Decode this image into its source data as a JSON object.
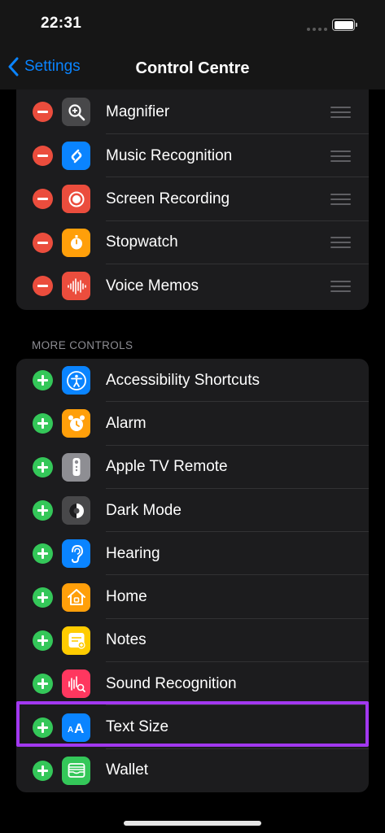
{
  "status_bar": {
    "time": "22:31"
  },
  "nav": {
    "back_label": "Settings",
    "title": "Control Centre"
  },
  "included_controls": [
    {
      "label": "Magnifier",
      "icon": "magnifier-icon",
      "color": "#48484a"
    },
    {
      "label": "Music Recognition",
      "icon": "shazam-icon",
      "color": "#0a84ff"
    },
    {
      "label": "Screen Recording",
      "icon": "screen-recording-icon",
      "color": "#eb4d3d"
    },
    {
      "label": "Stopwatch",
      "icon": "stopwatch-icon",
      "color": "#ff9f0a"
    },
    {
      "label": "Voice Memos",
      "icon": "voice-memos-icon",
      "color": "#eb4d3d"
    }
  ],
  "more_controls": {
    "header": "MORE CONTROLS",
    "items": [
      {
        "label": "Accessibility Shortcuts",
        "icon": "accessibility-icon",
        "color": "#0a84ff"
      },
      {
        "label": "Alarm",
        "icon": "alarm-icon",
        "color": "#ff9f0a"
      },
      {
        "label": "Apple TV Remote",
        "icon": "remote-icon",
        "color": "#8e8e93"
      },
      {
        "label": "Dark Mode",
        "icon": "dark-mode-icon",
        "color": "#48484a"
      },
      {
        "label": "Hearing",
        "icon": "ear-icon",
        "color": "#0a84ff"
      },
      {
        "label": "Home",
        "icon": "home-icon",
        "color": "#ff9f0a"
      },
      {
        "label": "Notes",
        "icon": "notes-icon",
        "color": "#ffcc00"
      },
      {
        "label": "Sound Recognition",
        "icon": "sound-recognition-icon",
        "color": "#ff375f"
      },
      {
        "label": "Text Size",
        "icon": "text-size-icon",
        "color": "#0a84ff"
      },
      {
        "label": "Wallet",
        "icon": "wallet-icon",
        "color": "#34c759"
      }
    ]
  },
  "highlight_color": "#a238f0"
}
